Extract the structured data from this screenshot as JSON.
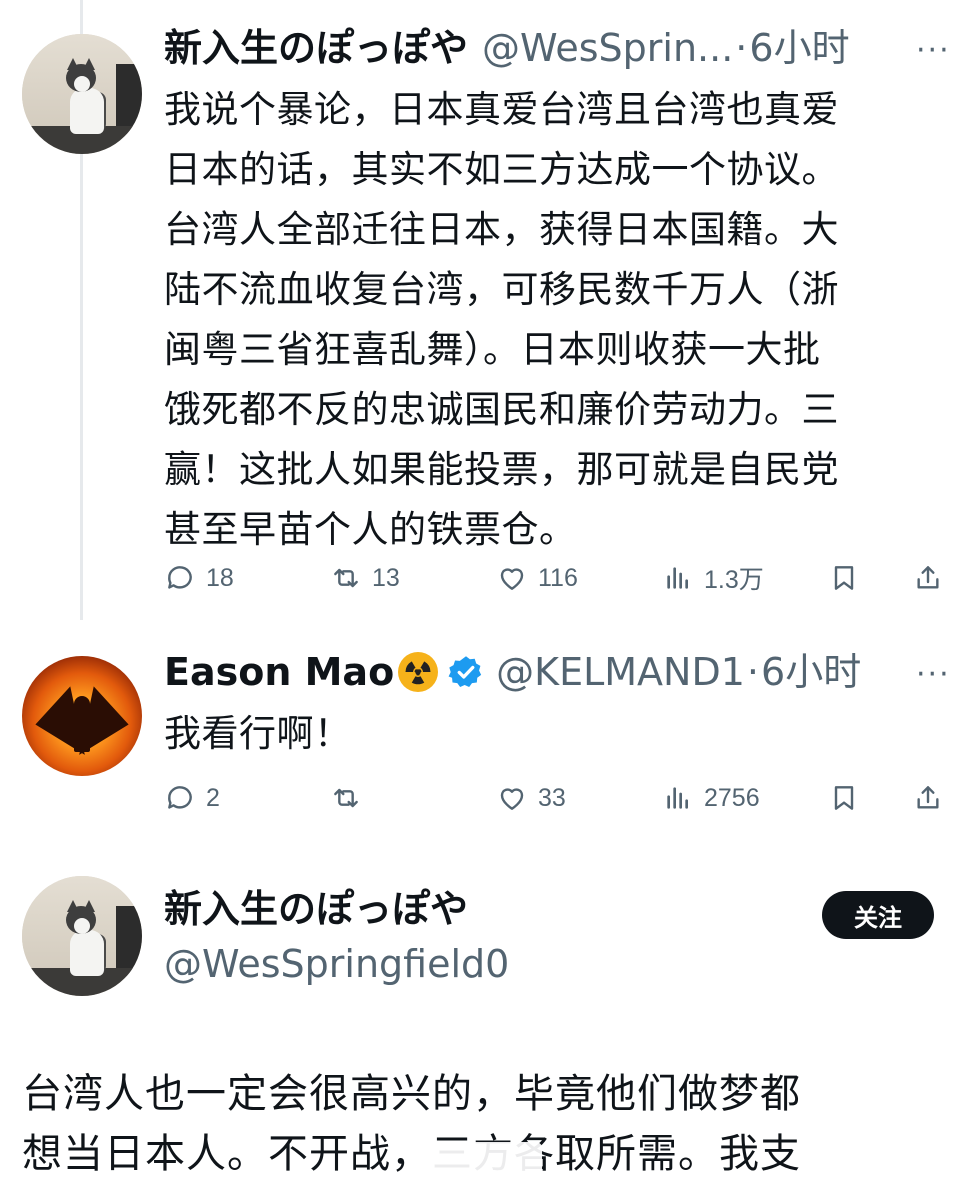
{
  "tweet1": {
    "name": "新入生のぽっぽや",
    "handle": "@WesSprin...",
    "dot": "·",
    "time": "6小时",
    "text": "我说个暴论，日本真爱台湾且台湾也真爱\n日本的话，其实不如三方达成一个协议。\n台湾人全部迁往日本，获得日本国籍。大\n陆不流血收复台湾，可移民数千万人（浙\n闽粤三省狂喜乱舞）。日本则收获一大批\n饿死都不反的忠诚国民和廉价劳动力。三\n赢！这批人如果能投票，那可就是自民党\n甚至早苗个人的铁票仓。",
    "replies": "18",
    "retweets": "13",
    "likes": "116",
    "views": "1.3万"
  },
  "tweet2": {
    "name": "Eason Mao",
    "handle": "@KELMAND1",
    "dot": "·",
    "time": "6小时",
    "text": "我看行啊！",
    "replies": "2",
    "retweets": "",
    "likes": "33",
    "views": "2756"
  },
  "profile": {
    "name": "新入生のぽっぽや",
    "handle": "@WesSpringfield0",
    "follow_label": "关注"
  },
  "tweet3": {
    "text": "台湾人也一定会很高兴的，毕竟他们做梦都\n想当日本人。不开战，三方各取所需。我支"
  },
  "more_glyph": "···",
  "colors": {
    "text": "#0f1419",
    "muted": "#536471",
    "verified": "#1d9bf0",
    "divider": "#e6e9ec"
  }
}
